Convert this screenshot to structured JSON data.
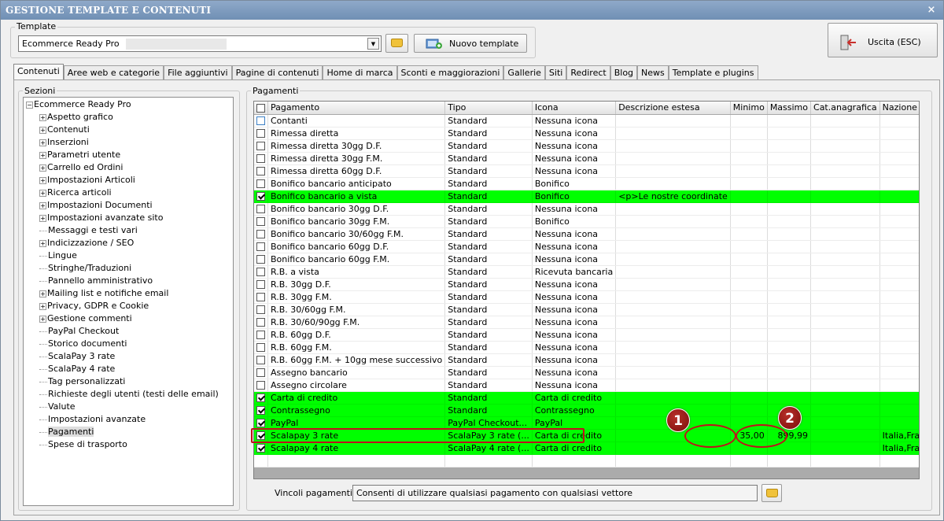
{
  "window": {
    "title": "GESTIONE TEMPLATE E CONTENUTI",
    "close": "×"
  },
  "template": {
    "group_label": "Template",
    "selected": "Ecommerce Ready Pro",
    "new_button": "Nuovo template",
    "exit_button": "Uscita (ESC)"
  },
  "tabs": [
    "Contenuti",
    "Aree web e categorie",
    "File aggiuntivi",
    "Pagine di contenuti",
    "Home di marca",
    "Sconti e maggiorazioni",
    "Gallerie",
    "Siti",
    "Redirect",
    "Blog",
    "News",
    "Template e plugins"
  ],
  "sections": {
    "label": "Sezioni",
    "root": "Ecommerce Ready Pro",
    "items": [
      {
        "label": "Aspetto grafico",
        "expandable": true
      },
      {
        "label": "Contenuti",
        "expandable": true
      },
      {
        "label": "Inserzioni",
        "expandable": true
      },
      {
        "label": "Parametri utente",
        "expandable": true
      },
      {
        "label": "Carrello ed Ordini",
        "expandable": true
      },
      {
        "label": "Impostazioni Articoli",
        "expandable": true
      },
      {
        "label": "Ricerca articoli",
        "expandable": true
      },
      {
        "label": "Impostazioni Documenti",
        "expandable": true
      },
      {
        "label": "Impostazioni avanzate sito",
        "expandable": true
      },
      {
        "label": "Messaggi e testi vari",
        "expandable": false
      },
      {
        "label": "Indicizzazione / SEO",
        "expandable": true
      },
      {
        "label": "Lingue",
        "expandable": false
      },
      {
        "label": "Stringhe/Traduzioni",
        "expandable": false
      },
      {
        "label": "Pannello amministrativo",
        "expandable": false
      },
      {
        "label": "Mailing list e notifiche email",
        "expandable": true
      },
      {
        "label": "Privacy, GDPR e Cookie",
        "expandable": true
      },
      {
        "label": "Gestione commenti",
        "expandable": true
      },
      {
        "label": "PayPal Checkout",
        "expandable": false
      },
      {
        "label": "Storico documenti",
        "expandable": false
      },
      {
        "label": "ScalaPay 3 rate",
        "expandable": false
      },
      {
        "label": "ScalaPay 4 rate",
        "expandable": false
      },
      {
        "label": "Tag personalizzati",
        "expandable": false
      },
      {
        "label": "Richieste degli utenti (testi delle email)",
        "expandable": false
      },
      {
        "label": "Valute",
        "expandable": false
      },
      {
        "label": "Impostazioni avanzate",
        "expandable": false
      },
      {
        "label": "Pagamenti",
        "expandable": false,
        "selected": true
      },
      {
        "label": "Spese di trasporto",
        "expandable": false
      }
    ]
  },
  "payments": {
    "label": "Pagamenti",
    "columns": [
      "Pagamento",
      "Tipo",
      "Icona",
      "Descrizione estesa",
      "Minimo",
      "Massimo",
      "Cat.anagrafica",
      "Nazione"
    ],
    "rows": [
      {
        "checked": false,
        "active": false,
        "cells": [
          "Contanti",
          "Standard",
          "Nessuna icona",
          "",
          "",
          "",
          "",
          ""
        ]
      },
      {
        "checked": false,
        "active": false,
        "cells": [
          "Rimessa diretta",
          "Standard",
          "Nessuna icona",
          "",
          "",
          "",
          "",
          ""
        ]
      },
      {
        "checked": false,
        "active": false,
        "cells": [
          "Rimessa diretta 30gg D.F.",
          "Standard",
          "Nessuna icona",
          "",
          "",
          "",
          "",
          ""
        ]
      },
      {
        "checked": false,
        "active": false,
        "cells": [
          "Rimessa diretta 30gg F.M.",
          "Standard",
          "Nessuna icona",
          "",
          "",
          "",
          "",
          ""
        ]
      },
      {
        "checked": false,
        "active": false,
        "cells": [
          "Rimessa diretta 60gg D.F.",
          "Standard",
          "Nessuna icona",
          "",
          "",
          "",
          "",
          ""
        ]
      },
      {
        "checked": false,
        "active": false,
        "cells": [
          "Bonifico bancario anticipato",
          "Standard",
          "Bonifico",
          "",
          "",
          "",
          "",
          ""
        ]
      },
      {
        "checked": true,
        "active": true,
        "cells": [
          "Bonifico bancario a vista",
          "Standard",
          "Bonifico",
          "<p>Le nostre coordinate",
          "",
          "",
          "",
          ""
        ]
      },
      {
        "checked": false,
        "active": false,
        "cells": [
          "Bonifico bancario 30gg D.F.",
          "Standard",
          "Nessuna icona",
          "",
          "",
          "",
          "",
          ""
        ]
      },
      {
        "checked": false,
        "active": false,
        "cells": [
          "Bonifico bancario 30gg F.M.",
          "Standard",
          "Bonifico",
          "",
          "",
          "",
          "",
          ""
        ]
      },
      {
        "checked": false,
        "active": false,
        "cells": [
          "Bonifico bancario 30/60gg F.M.",
          "Standard",
          "Nessuna icona",
          "",
          "",
          "",
          "",
          ""
        ]
      },
      {
        "checked": false,
        "active": false,
        "cells": [
          "Bonifico bancario 60gg D.F.",
          "Standard",
          "Nessuna icona",
          "",
          "",
          "",
          "",
          ""
        ]
      },
      {
        "checked": false,
        "active": false,
        "cells": [
          "Bonifico bancario 60gg F.M.",
          "Standard",
          "Nessuna icona",
          "",
          "",
          "",
          "",
          ""
        ]
      },
      {
        "checked": false,
        "active": false,
        "cells": [
          "R.B. a vista",
          "Standard",
          "Ricevuta bancaria",
          "",
          "",
          "",
          "",
          ""
        ]
      },
      {
        "checked": false,
        "active": false,
        "cells": [
          "R.B. 30gg D.F.",
          "Standard",
          "Nessuna icona",
          "",
          "",
          "",
          "",
          ""
        ]
      },
      {
        "checked": false,
        "active": false,
        "cells": [
          "R.B. 30gg F.M.",
          "Standard",
          "Nessuna icona",
          "",
          "",
          "",
          "",
          ""
        ]
      },
      {
        "checked": false,
        "active": false,
        "cells": [
          "R.B. 30/60gg F.M.",
          "Standard",
          "Nessuna icona",
          "",
          "",
          "",
          "",
          ""
        ]
      },
      {
        "checked": false,
        "active": false,
        "cells": [
          "R.B. 30/60/90gg F.M.",
          "Standard",
          "Nessuna icona",
          "",
          "",
          "",
          "",
          ""
        ]
      },
      {
        "checked": false,
        "active": false,
        "cells": [
          "R.B. 60gg D.F.",
          "Standard",
          "Nessuna icona",
          "",
          "",
          "",
          "",
          ""
        ]
      },
      {
        "checked": false,
        "active": false,
        "cells": [
          "R.B. 60gg F.M.",
          "Standard",
          "Nessuna icona",
          "",
          "",
          "",
          "",
          ""
        ]
      },
      {
        "checked": false,
        "active": false,
        "cells": [
          "R.B. 60gg F.M. + 10gg mese successivo",
          "Standard",
          "Nessuna icona",
          "",
          "",
          "",
          "",
          ""
        ]
      },
      {
        "checked": false,
        "active": false,
        "cells": [
          "Assegno bancario",
          "Standard",
          "Nessuna icona",
          "",
          "",
          "",
          "",
          ""
        ]
      },
      {
        "checked": false,
        "active": false,
        "cells": [
          "Assegno circolare",
          "Standard",
          "Nessuna icona",
          "",
          "",
          "",
          "",
          ""
        ]
      },
      {
        "checked": true,
        "active": true,
        "cells": [
          "Carta di credito",
          "Standard",
          "Carta di credito",
          "",
          "",
          "",
          "",
          ""
        ]
      },
      {
        "checked": true,
        "active": true,
        "cells": [
          "Contrassegno",
          "Standard",
          "Contrassegno",
          "",
          "",
          "",
          "",
          ""
        ]
      },
      {
        "checked": true,
        "active": true,
        "cells": [
          "PayPal",
          "PayPal Checkout...",
          "PayPal",
          "",
          "",
          "",
          "",
          ""
        ]
      },
      {
        "checked": true,
        "active": true,
        "cells": [
          "Scalapay 3 rate",
          "ScalaPay 3 rate (...",
          "Carta di credito",
          "",
          "35,00",
          "899,99",
          "",
          "Italia,Francia,G..."
        ]
      },
      {
        "checked": true,
        "active": true,
        "cells": [
          "Scalapay 4 rate",
          "ScalaPay 4 rate (...",
          "Carta di credito",
          "",
          "",
          "",
          "",
          "Italia,Francia,G..."
        ]
      }
    ],
    "callouts": [
      "1",
      "2"
    ]
  },
  "constraints": {
    "label": "Vincoli pagamenti :",
    "value": "Consenti di utilizzare qualsiasi pagamento con qualsiasi vettore"
  }
}
